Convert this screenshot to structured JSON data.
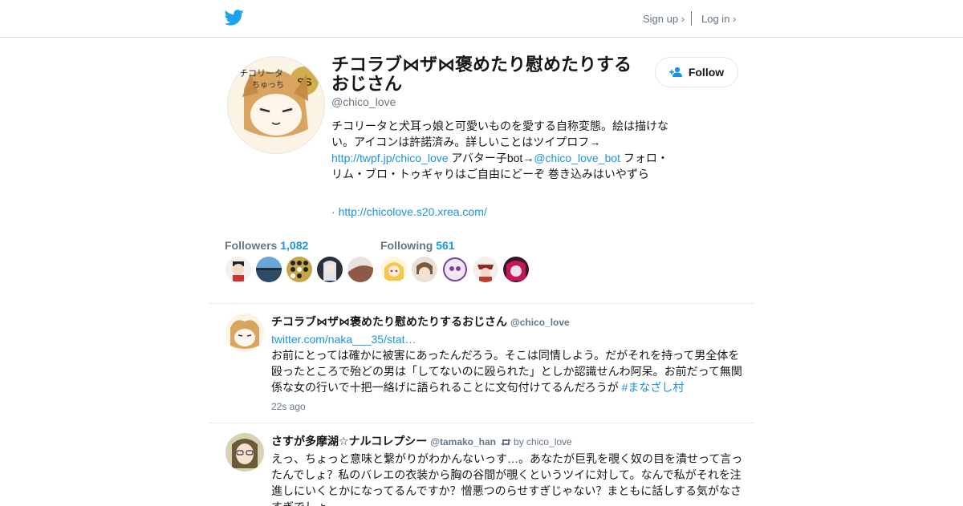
{
  "header": {
    "logo": "twitter-bird-icon",
    "signup_label": "Sign up ›",
    "login_label": "Log in ›"
  },
  "profile": {
    "name": "チコラブ⋈ザ⋈褒めたり慰めたりするおじさん",
    "handle": "@chico_love",
    "bio_text_1": "チコリータと犬耳っ娘と可愛いものを愛する自称変態。絵は描けない。アイコンは許諾済み。詳しいことはツイプロフ→",
    "bio_link": "http://twpf.jp/chico_love",
    "bio_text_2": " アバター子bot→",
    "bio_mention": "@chico_love_bot",
    "bio_text_3": " フォロ・リム・ブロ・トゥギャりはご自由にどーぞ 巻き込みはいやずら",
    "website_prefix": "· ",
    "website": "http://chicolove.s20.xrea.com/",
    "follow_label": "Follow"
  },
  "stats": {
    "followers_label": "Followers",
    "followers_count": "1,082",
    "following_label": "Following",
    "following_count": "561"
  },
  "tweets": [
    {
      "name": "チコラブ⋈ザ⋈褒めたり慰めたりするおじさん",
      "handle": "@chico_love",
      "link": "twitter.com/naka___35/stat…",
      "text": "お前にとっては確かに被害にあったんだろう。そこは同情しよう。だがそれを持って男全体を殴ったところで殆どの男は「してないのに殴られた」としか認識せんわ阿呆。お前だって無関係な女の行いで十把一絡げに語られることに文句付けてるんだろうが ",
      "hashtag": "#まなざし村",
      "time": "22s ago"
    },
    {
      "name": "さすが多摩湖☆ナルコレプシー",
      "handle": "@tamako_han",
      "retweet_by": "by chico_love",
      "text": "えっ、ちょっと意味と繋がりがわかんないっす…。あなたが巨乳を覗く奴の目を潰せって言ったんでしょ？私のバレエの衣装から胸の谷間が覗くというツイに対して。なんで私がそれを注進しにいくとかになってるんですか？憎悪つのらせすぎじゃない？まともに話しする気がなさすぎでしょ "
    }
  ],
  "colors": {
    "link": "#1b95e0",
    "muted": "#657786",
    "text": "#14171a",
    "border": "#e6ecf0"
  }
}
